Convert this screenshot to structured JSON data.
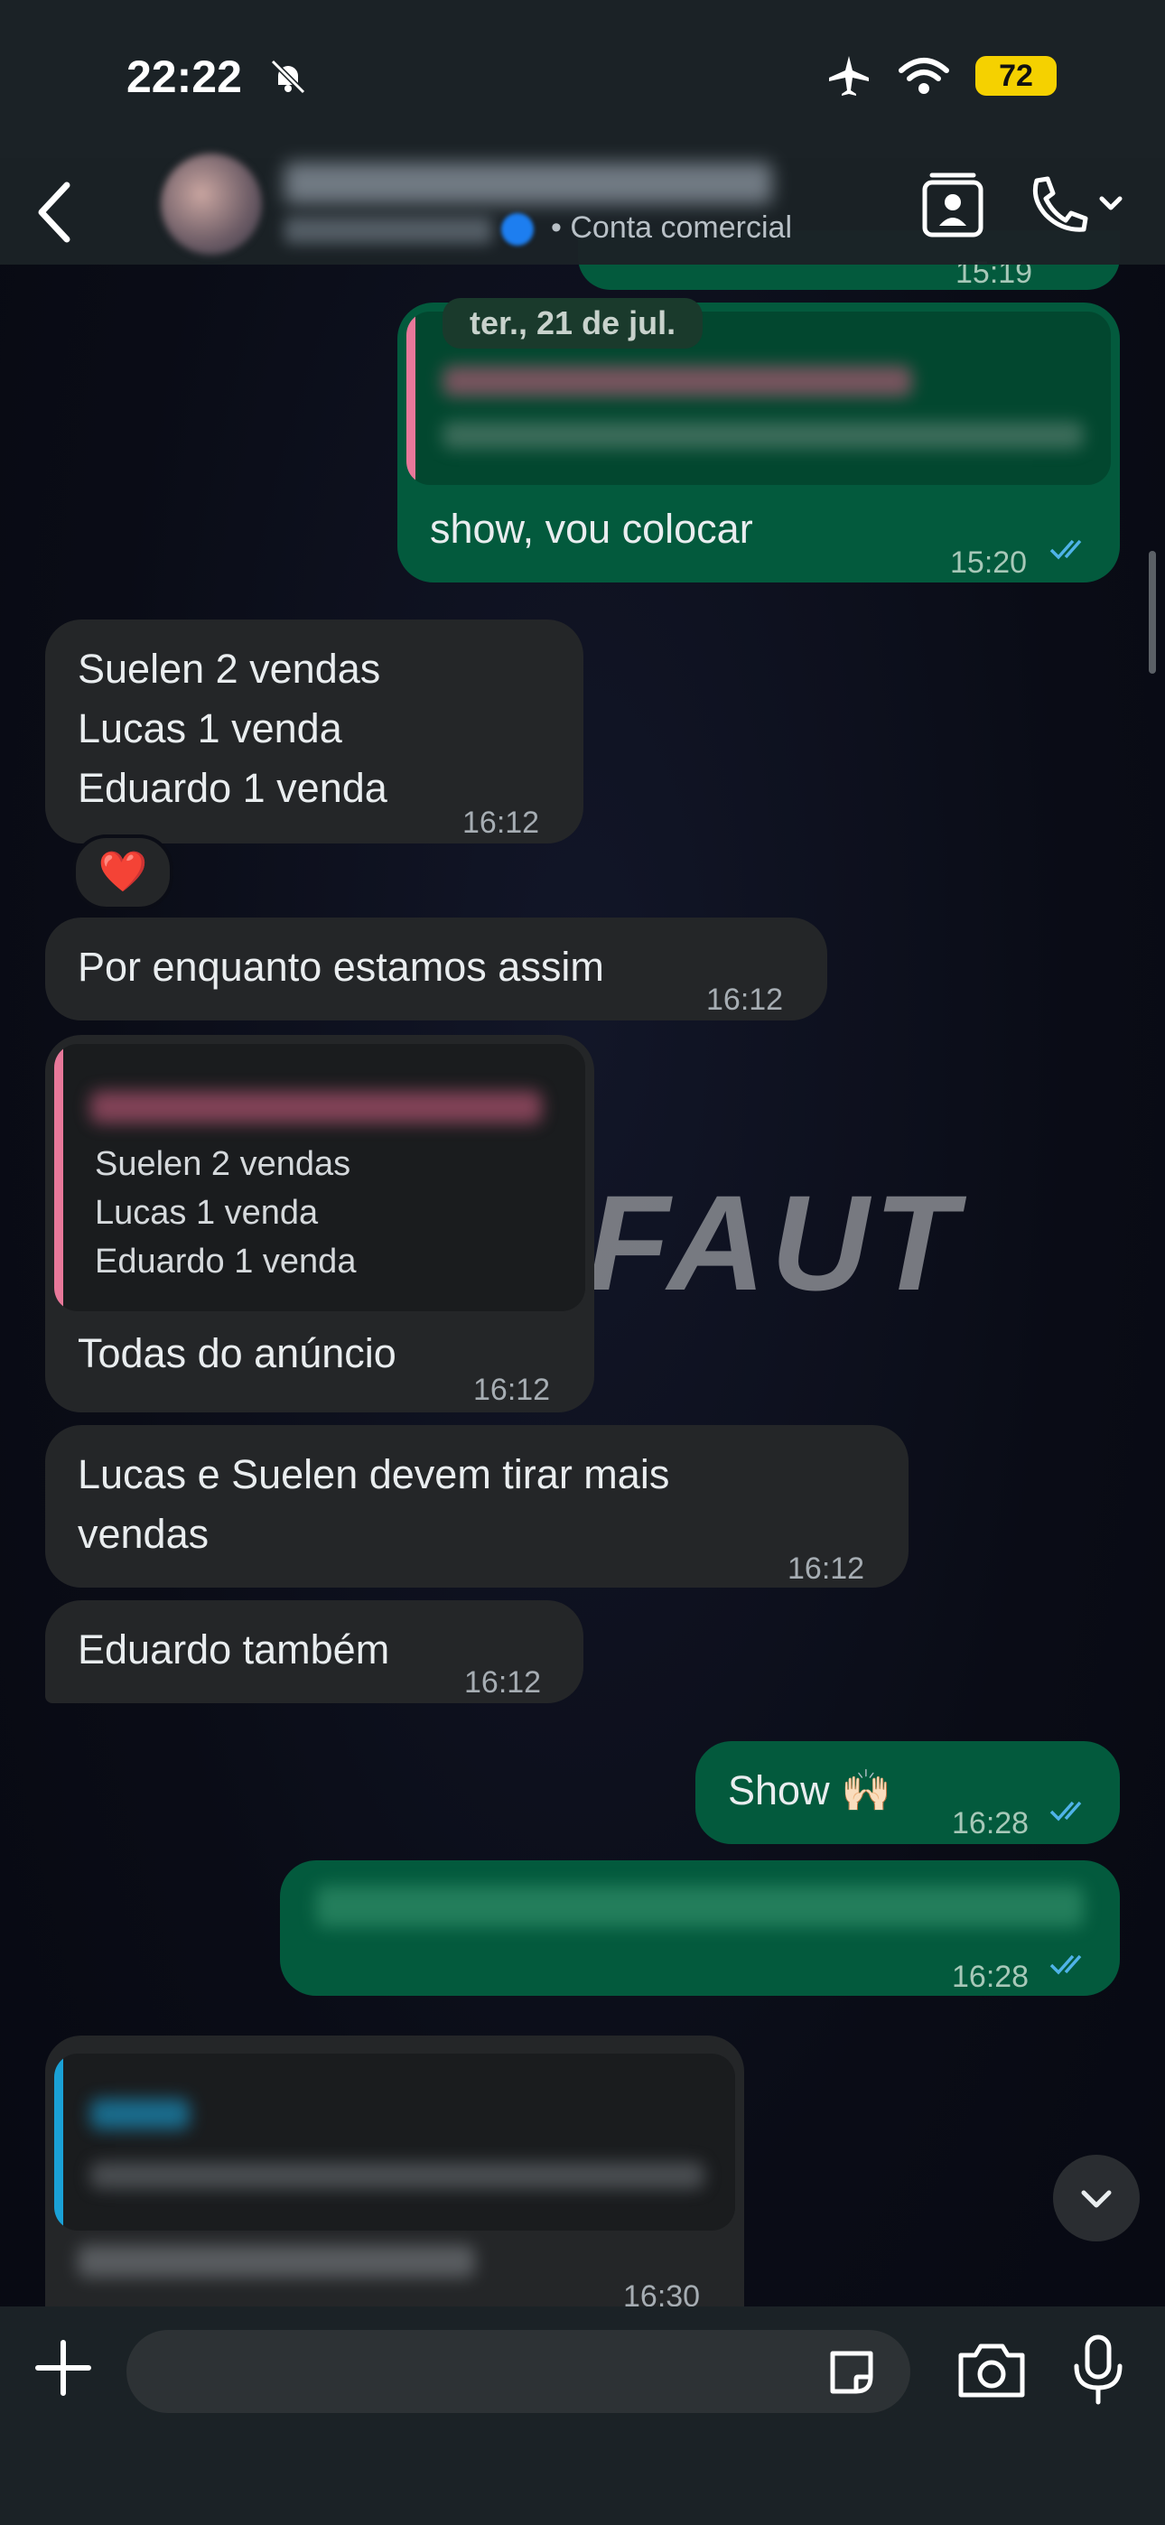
{
  "status": {
    "time": "22:22",
    "battery": "72"
  },
  "header": {
    "business_label": "• Conta comercial"
  },
  "chat": {
    "date_chip": "ter., 21 de jul.",
    "partial_time": "15:19",
    "msg_out_1": {
      "text": "show, vou colocar",
      "time": "15:20"
    },
    "msg_in_1": {
      "lines": [
        "Suelen 2 vendas",
        "Lucas 1 venda",
        "Eduardo 1 venda"
      ],
      "time": "16:12",
      "reaction": "❤️"
    },
    "msg_in_2": {
      "text": "Por enquanto estamos assim",
      "time": "16:12"
    },
    "msg_in_3": {
      "quote_lines": [
        "Suelen 2 vendas",
        "Lucas 1 venda",
        "Eduardo 1 venda"
      ],
      "text": "Todas do anúncio",
      "time": "16:12"
    },
    "msg_in_4": {
      "line1": "Lucas e Suelen devem tirar mais",
      "line2": "vendas",
      "time": "16:12"
    },
    "msg_in_5": {
      "text": "Eduardo também",
      "time": "16:12"
    },
    "msg_out_2": {
      "text": "Show 🙌🏻",
      "time": "16:28"
    },
    "msg_out_3": {
      "time": "16:28"
    },
    "msg_in_6": {
      "time": "16:30"
    },
    "watermark": "FAUT"
  },
  "composer": {
    "placeholder": ""
  }
}
